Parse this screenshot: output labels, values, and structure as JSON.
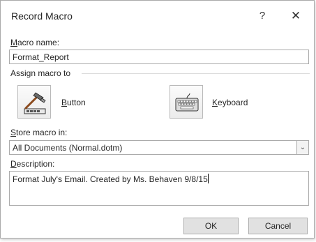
{
  "dialog": {
    "title": "Record Macro",
    "help_label": "?",
    "close_label": "✕"
  },
  "macro_name": {
    "label_underlined": "M",
    "label_rest": "acro name:",
    "value": "Format_Report"
  },
  "assign": {
    "label": "Assign macro to",
    "button_label_underlined": "B",
    "button_label_rest": "utton",
    "keyboard_label_underlined": "K",
    "keyboard_label_rest": "eyboard",
    "button_icon": "hammer-toolbar-icon",
    "keyboard_icon": "keyboard-icon"
  },
  "store": {
    "label_underlined": "S",
    "label_rest": "tore macro in:",
    "selected": "All Documents (Normal.dotm)"
  },
  "description": {
    "label_underlined": "D",
    "label_rest": "escription:",
    "value": "Format July's Email. Created by Ms. Behaven 9/8/15"
  },
  "actions": {
    "ok": "OK",
    "cancel": "Cancel"
  },
  "colors": {
    "border": "#ababab",
    "button_bg": "#e1e1e1"
  }
}
